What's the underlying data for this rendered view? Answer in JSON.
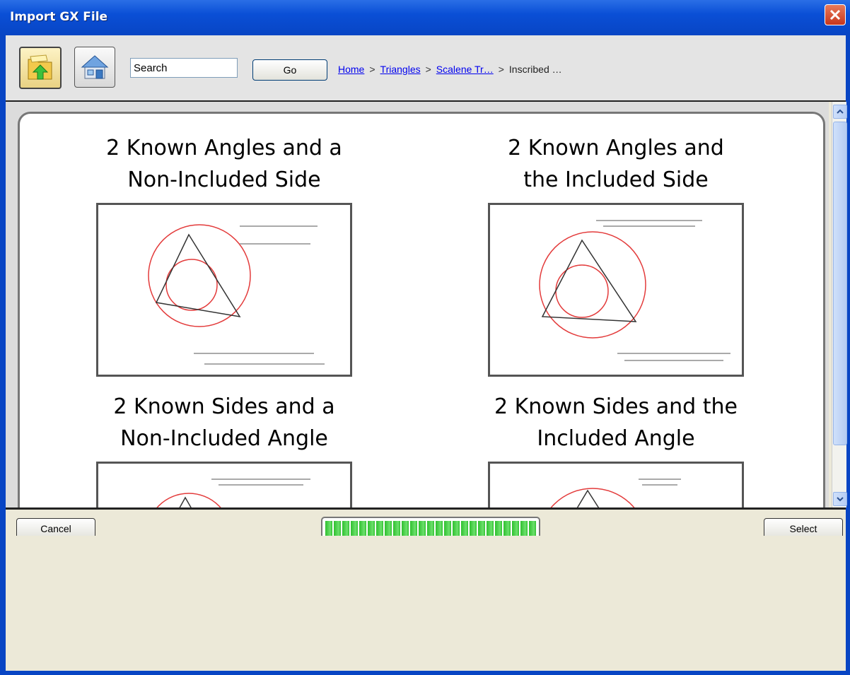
{
  "window": {
    "title": "Import GX File"
  },
  "toolbar": {
    "search_value": "Search",
    "go_label": "Go",
    "breadcrumbs": [
      "Home",
      "Triangles",
      "Scalene Tr…",
      "Inscribed …"
    ],
    "separator": ">"
  },
  "cards": [
    {
      "title_line1": "2 Known Angles and a",
      "title_line2": "Non-Included Side"
    },
    {
      "title_line1": "2 Known Angles and",
      "title_line2": "the Included Side"
    },
    {
      "title_line1": "2 Known Sides and a",
      "title_line2": "Non-Included Angle"
    },
    {
      "title_line1": "2 Known Sides and the",
      "title_line2": "Included Angle"
    }
  ],
  "footer": {
    "cancel_label": "Cancel",
    "select_label": "Select",
    "progress": 1.0
  },
  "colors": {
    "titlebar": "#0a4fd6",
    "circle": "#e33b3b",
    "progress": "#2fc02f"
  }
}
